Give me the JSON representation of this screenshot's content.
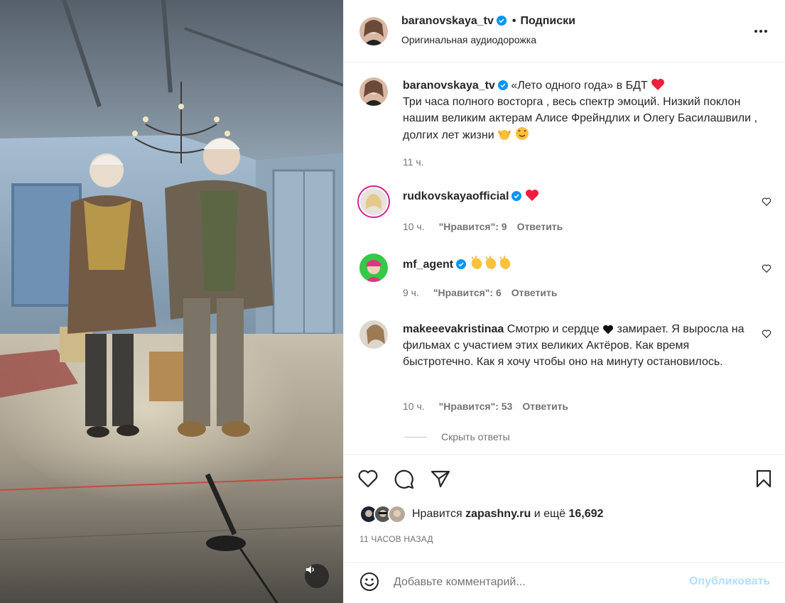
{
  "media": {
    "mute_icon": "speaker-icon"
  },
  "header": {
    "username": "baranovskaya_tv",
    "separator": "•",
    "follow_label": "Подписки",
    "audio_label": "Оригинальная аудиодорожка"
  },
  "caption": {
    "username": "baranovskaya_tv",
    "text_line1": "«Лето одного года» в БДТ",
    "text_rest": "Три часа полного восторга , весь спектр эмоций. Низкий поклон нашим великим актерам Алисе Фрейндлих и Олегу Басилашвили , долгих лет жизни",
    "time": "11 ч."
  },
  "comments": [
    {
      "username": "rudkovskaya​official",
      "text": "",
      "time": "10 ч.",
      "likes_label": "\"Нравится\": 9",
      "reply_label": "Ответить",
      "verified": true
    },
    {
      "username": "mf_agent",
      "text": "",
      "time": "9 ч.",
      "likes_label": "\"Нравится\": 6",
      "reply_label": "Ответить",
      "verified": true
    },
    {
      "username": "makeeevakristinaa",
      "text_before": "Смотрю и сердце",
      "text_after": "замирает. Я выросла на фильмах с участием этих великих Актёров. Как время быстротечно. Как я хочу чтобы оно на минуту остановилось.",
      "time": "10 ч.",
      "likes_label": "\"Нравится\": 53",
      "reply_label": "Ответить",
      "verified": false
    }
  ],
  "hide_replies_label": "Скрыть ответы",
  "likes": {
    "prefix": "Нравится",
    "user": "zapashny.ru",
    "middle": "и ещё",
    "count": "16,692"
  },
  "time_ago": "11 ЧАСОВ НАЗАД",
  "comment_box": {
    "placeholder": "Добавьте комментарий...",
    "publish_label": "Опубликовать"
  },
  "colors": {
    "verified": "#0095f6",
    "heart": "#ed1e3e",
    "publish": "#b2dffc"
  }
}
